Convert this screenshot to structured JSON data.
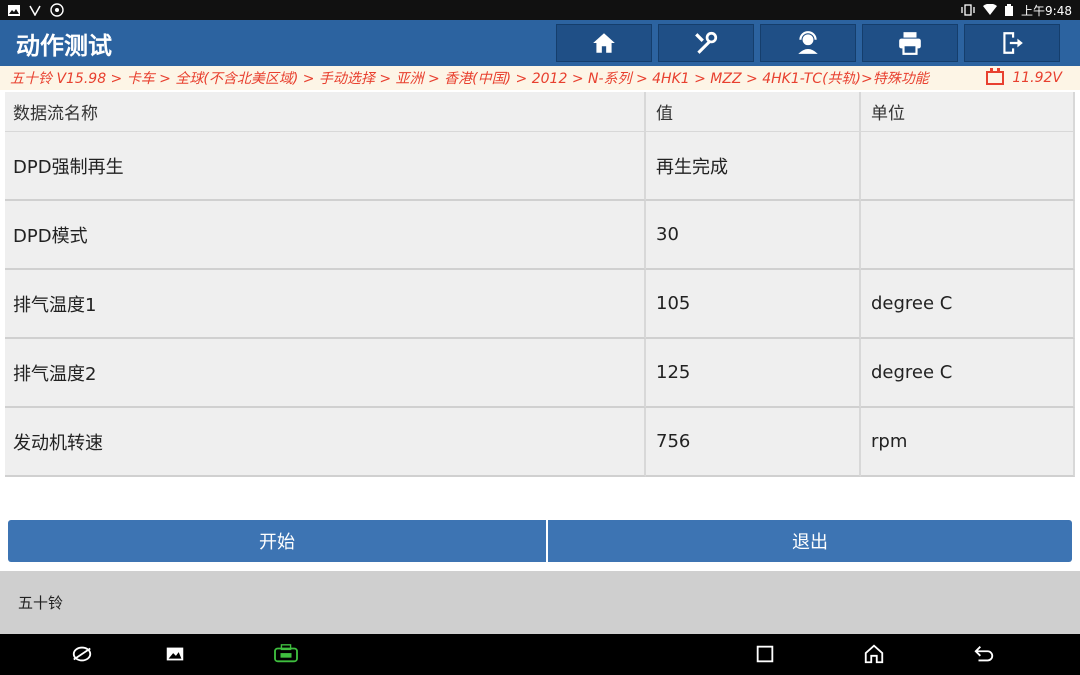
{
  "status_bar": {
    "time": "上午9:48"
  },
  "header": {
    "title": "动作测试",
    "toolbar": [
      {
        "name": "home-icon"
      },
      {
        "name": "diagnose-icon"
      },
      {
        "name": "support-icon"
      },
      {
        "name": "print-icon"
      },
      {
        "name": "exit-icon"
      }
    ]
  },
  "breadcrumb": {
    "path": "五十铃 V15.98 > 卡车 > 全球(不含北美区域) > 手动选择 > 亚洲 > 香港(中国) > 2012 > N-系列 > 4HK1 > MZZ > 4HK1-TC(共轨)>特殊功能",
    "voltage": "11.92V"
  },
  "table": {
    "headers": [
      "数据流名称",
      "值",
      "单位"
    ],
    "rows": [
      {
        "name": "DPD强制再生",
        "value": "再生完成",
        "unit": ""
      },
      {
        "name": "DPD模式",
        "value": "30",
        "unit": ""
      },
      {
        "name": "排气温度1",
        "value": "105",
        "unit": "degree C"
      },
      {
        "name": "排气温度2",
        "value": "125",
        "unit": "degree C"
      },
      {
        "name": "发动机转速",
        "value": "756",
        "unit": "rpm"
      }
    ]
  },
  "buttons": {
    "start": "开始",
    "exit": "退出"
  },
  "footer": {
    "brand": "五十铃"
  },
  "colors": {
    "header_bg": "#2c63a0",
    "button_bg": "#3d74b3",
    "breadcrumb_text": "#e8402f"
  }
}
